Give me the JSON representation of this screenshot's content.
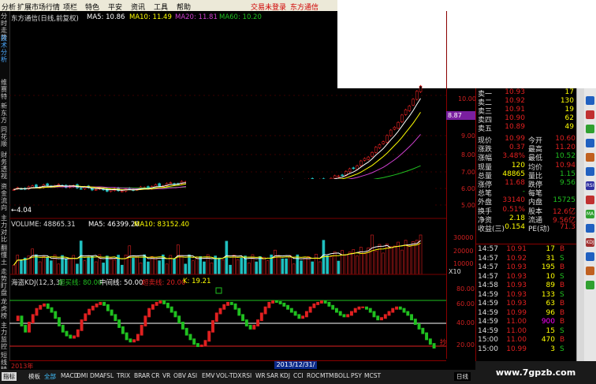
{
  "menubar": {
    "items": [
      "分析",
      "扩展市场行情",
      "项栏",
      "特色",
      "平安",
      "资讯",
      "工具",
      "帮助"
    ],
    "login": "交易未登录",
    "broker": "东方通信"
  },
  "lefttabs": [
    "分时走势",
    "技术分析",
    "维赛特",
    "新东方",
    "同花顺",
    "财务透视",
    "资金流向",
    "主力对比",
    "翻懂土",
    "走势盯盘",
    "龙虎榜",
    "主力监控",
    "短线精灵",
    "理财"
  ],
  "main_chart": {
    "title": "东方通信(日线,前复权)",
    "ma5": "MA5: 10.86",
    "ma10": "MA10: 11.49",
    "ma20": "MA20: 11.81",
    "ma60": "MA60: 10.20",
    "low_mark": "←4.04",
    "price_tag": "8.87",
    "axis_labels": [
      "10.00",
      "9.00",
      "8.00",
      "7.00",
      "6.00",
      "5.00"
    ]
  },
  "volume_panel": {
    "label": "VOLUME: 48865.31",
    "ma5": "MA5: 46399.20",
    "ma10": "MA10: 83152.40",
    "axis_labels": [
      "30000",
      "20000",
      "10000"
    ],
    "unit": "X10"
  },
  "kdj_panel": {
    "title": "海盗KDJ(12,3,3)",
    "overbought": "超买线: 80.00",
    "middle": "中间线: 50.00",
    "oversold": "超卖线: 20.00",
    "k_value": "K: 19.21",
    "axis_labels": [
      "80.00",
      "60.00",
      "40.00",
      "20.00"
    ],
    "buy_tag": "抄"
  },
  "kdj_chart": {
    "type": "bar",
    "values": [
      55,
      60,
      48,
      40,
      52,
      62,
      70,
      74,
      76,
      71,
      66,
      58,
      48,
      40,
      35,
      32,
      34,
      42,
      55,
      63,
      69,
      73,
      76,
      78,
      75,
      68,
      62,
      55,
      46,
      38,
      30,
      27,
      29,
      36,
      48,
      60,
      70,
      75,
      78,
      80,
      77,
      72,
      66,
      60,
      52,
      44,
      36,
      30,
      24,
      21,
      22,
      28,
      40,
      54,
      64,
      70,
      75,
      78,
      76,
      70,
      62,
      55,
      48,
      44,
      48,
      55,
      64,
      72,
      78,
      80,
      79,
      77,
      74,
      70,
      66,
      62,
      58,
      60,
      66,
      72,
      76,
      78,
      80,
      78,
      74,
      70,
      66,
      62,
      60,
      62,
      66,
      70,
      72,
      72,
      70,
      66,
      60,
      56,
      58,
      62,
      66,
      70,
      72,
      70,
      66,
      62,
      56,
      50,
      44,
      38,
      30,
      24,
      19
    ],
    "ylim": [
      0,
      100
    ]
  },
  "time_strip": {
    "start_label": "2013年",
    "date_tag": "2013/12/31/二"
  },
  "quote": {
    "asks": [
      {
        "label": "卖一",
        "price": "10.93",
        "vol": "17"
      },
      {
        "label": "卖二",
        "price": "10.92",
        "vol": "130"
      },
      {
        "label": "卖三",
        "price": "10.91",
        "vol": "19"
      },
      {
        "label": "卖四",
        "price": "10.90",
        "vol": "62"
      },
      {
        "label": "卖五",
        "price": "10.89",
        "vol": "49"
      }
    ],
    "stats": [
      {
        "l1": "现价",
        "v1": "10.99",
        "l2": "今开",
        "v2": "10.60"
      },
      {
        "l1": "涨跌",
        "v1": "0.37",
        "l2": "最高",
        "v2": "11.20"
      },
      {
        "l1": "涨幅",
        "v1": "3.48%",
        "l2": "最低",
        "v2": "10.52"
      },
      {
        "l1": "现量",
        "v1": "120",
        "l2": "均价",
        "v2": "10.94"
      },
      {
        "l1": "总量",
        "v1": "48865",
        "l2": "量比",
        "v2": "1.15"
      },
      {
        "l1": "涨停",
        "v1": "11.68",
        "l2": "跌停",
        "v2": "9.56"
      },
      {
        "l1": "总笔",
        "v1": "-",
        "l2": "每笔",
        "v2": ""
      },
      {
        "l1": "外盘",
        "v1": "33140",
        "l2": "内盘",
        "v2": "15725"
      },
      {
        "l1": "换手",
        "v1": "0.51%",
        "l2": "股本",
        "v2": "12.6亿"
      },
      {
        "l1": "净资",
        "v1": "2.18",
        "l2": "流通",
        "v2": "9.56亿"
      },
      {
        "l1": "收益(三)",
        "v1": "0.154",
        "l2": "PE(动)",
        "v2": "71.3"
      }
    ],
    "ticks": [
      {
        "time": "14:57",
        "price": "10.91",
        "vol": "17",
        "side": "B"
      },
      {
        "time": "14:57",
        "price": "10.92",
        "vol": "31",
        "side": "S"
      },
      {
        "time": "14:57",
        "price": "10.93",
        "vol": "195",
        "side": "B"
      },
      {
        "time": "14:57",
        "price": "10.93",
        "vol": "10",
        "side": "S"
      },
      {
        "time": "14:58",
        "price": "10.93",
        "vol": "89",
        "side": "B"
      },
      {
        "time": "14:59",
        "price": "10.93",
        "vol": "133",
        "side": "S"
      },
      {
        "time": "14:59",
        "price": "10.93",
        "vol": "63",
        "side": "B"
      },
      {
        "time": "14:59",
        "price": "10.99",
        "vol": "96",
        "side": "B"
      },
      {
        "time": "14:59",
        "price": "11.00",
        "vol": "900",
        "side": "B"
      },
      {
        "time": "14:59",
        "price": "11.00",
        "vol": "15",
        "side": "S"
      },
      {
        "time": "15:00",
        "price": "11.00",
        "vol": "470",
        "side": "B"
      },
      {
        "time": "15:00",
        "price": "10.99",
        "vol": "3",
        "side": "S"
      }
    ]
  },
  "sidetools": [
    "RSI",
    "MA",
    "KDJ"
  ],
  "bottom": {
    "tabs": [
      "指标",
      "模板",
      "全部",
      "MACD",
      "DMI",
      "DMA",
      "FSL",
      "TRIX",
      "BRAR",
      "CR",
      "VR",
      "OBV",
      "ASI",
      "EMV",
      "VOL-TDX",
      "RSI",
      "WR",
      "SAR",
      "KDJ",
      "CCI",
      "ROC",
      "MTM",
      "BOLL",
      "PSY",
      "MCST"
    ],
    "period": "日线"
  },
  "watermark": "www.7gpzb.com",
  "colors": {
    "up": "#e02020",
    "down": "#20c020",
    "ma5": "#ffffff",
    "ma10": "#ffff00",
    "ma20": "#d040d0",
    "ma60": "#20c020",
    "kdj_line": "#20c020"
  }
}
